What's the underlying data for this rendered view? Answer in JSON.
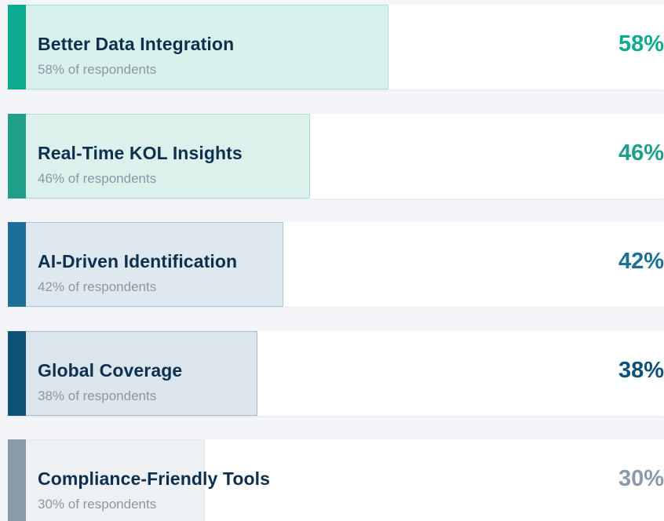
{
  "chart_data": {
    "type": "bar",
    "orientation": "horizontal",
    "categories": [
      "Better Data Integration",
      "Real-Time KOL Insights",
      "AI-Driven Identification",
      "Global Coverage",
      "Compliance-Friendly Tools"
    ],
    "values": [
      58,
      46,
      42,
      38,
      30
    ],
    "xlim": [
      0,
      100
    ],
    "grid": false,
    "bars": [
      {
        "label": "Better Data Integration",
        "value": 58,
        "value_label": "58%",
        "sublabel": "58% of respondents",
        "accent_color": "#0aab8f",
        "fill_color": "#d8f1ed",
        "fill_border": "#a8e0d6",
        "value_color": "#0aab8f"
      },
      {
        "label": "Real-Time KOL Insights",
        "value": 46,
        "value_label": "46%",
        "sublabel": "46% of respondents",
        "accent_color": "#1f9e8a",
        "fill_color": "#dcf1ec",
        "fill_border": "#b2e0d7",
        "value_color": "#1f9e8a"
      },
      {
        "label": "AI-Driven Identification",
        "value": 42,
        "value_label": "42%",
        "sublabel": "42% of respondents",
        "accent_color": "#1d6f97",
        "fill_color": "#dde9ef",
        "fill_border": "#a9c7d7",
        "value_color": "#1d6f97"
      },
      {
        "label": "Global Coverage",
        "value": 38,
        "value_label": "38%",
        "sublabel": "38% of respondents",
        "accent_color": "#0e5278",
        "fill_color": "#dbe5ec",
        "fill_border": "#a7bccb",
        "value_color": "#0e5278"
      },
      {
        "label": "Compliance-Friendly Tools",
        "value": 30,
        "value_label": "30%",
        "sublabel": "30% of respondents",
        "accent_color": "#8b9aaa",
        "fill_color": "#eef1f4",
        "fill_border": "#e5e9ee",
        "value_color": "#8b9aaa"
      }
    ]
  }
}
